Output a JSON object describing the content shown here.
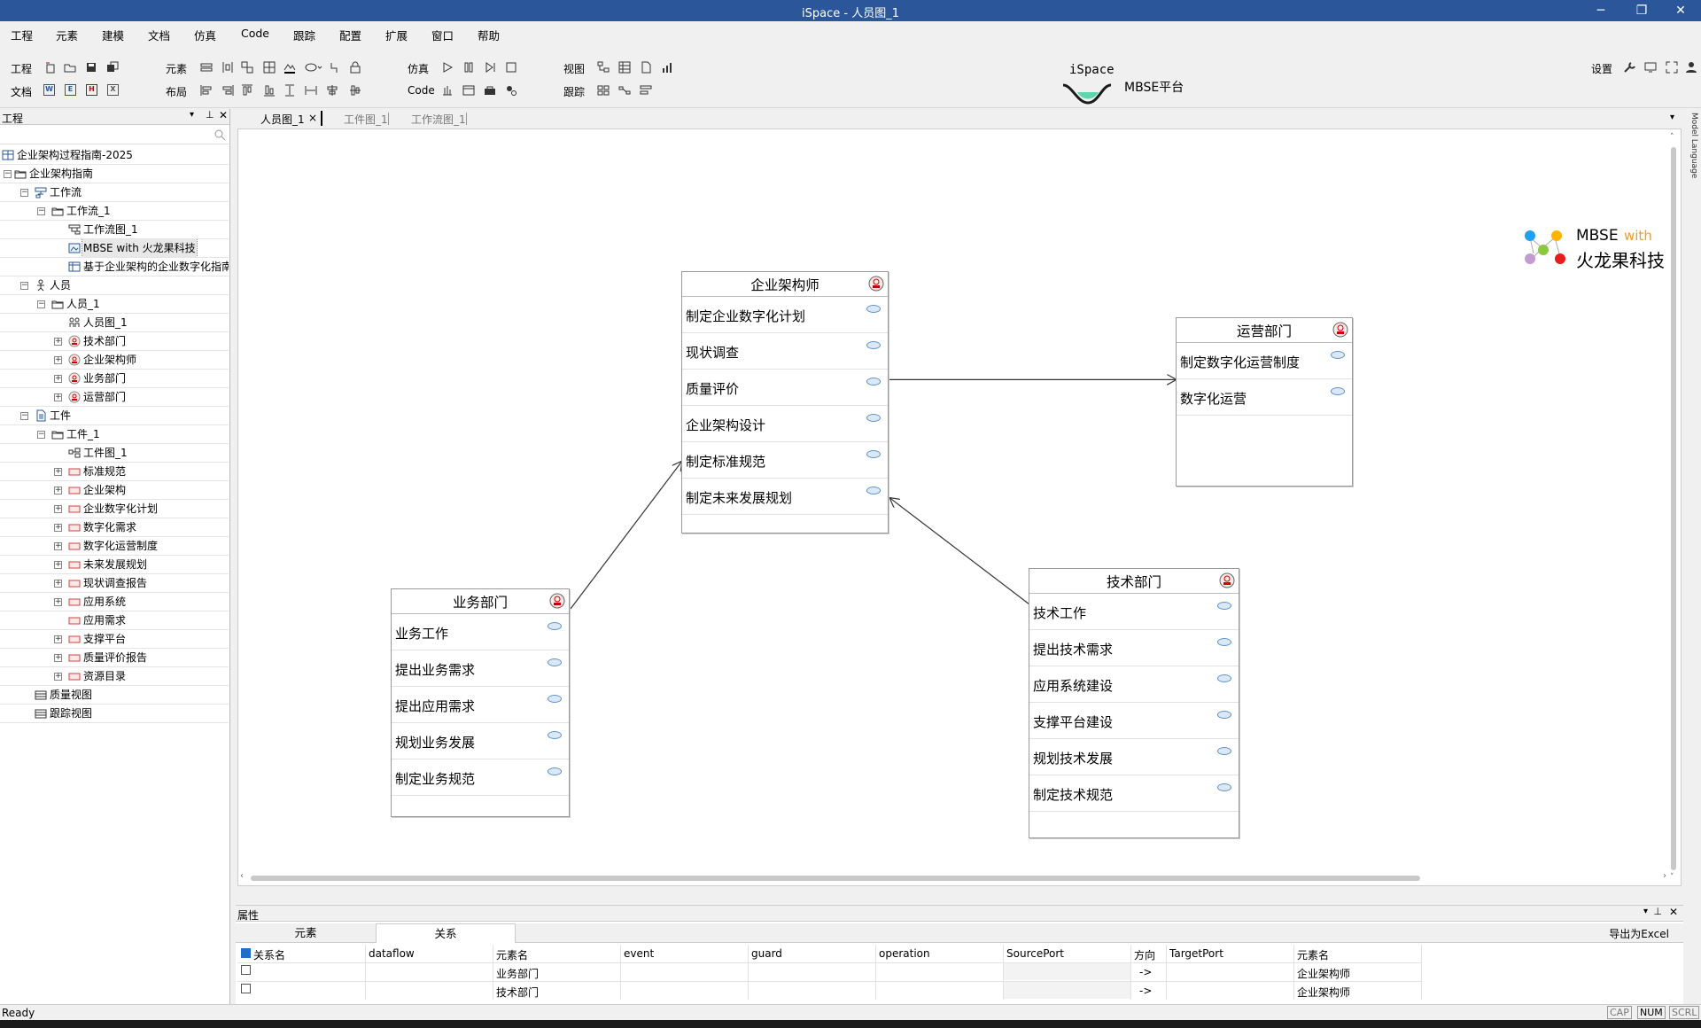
{
  "window": {
    "title": "iSpace - 人员图_1",
    "controls": [
      "─",
      "❐",
      "✕"
    ]
  },
  "menu": [
    "工程",
    "元素",
    "建模",
    "文档",
    "仿真",
    "Code",
    "跟踪",
    "配置",
    "扩展",
    "窗口",
    "帮助"
  ],
  "toolbar": {
    "groups": {
      "project": "工程",
      "document": "文档",
      "element": "元素",
      "layout": "布局",
      "simulate": "仿真",
      "code": "Code",
      "view": "视图",
      "trace": "跟踪"
    },
    "doc_icons": [
      "W",
      "E",
      "H",
      "X"
    ],
    "brand_title": "iSpace",
    "brand_sub": "MBSE平台",
    "settings": "设置"
  },
  "left_panel": {
    "title": "工程",
    "tree": [
      {
        "label": "企业架构过程指南-2025",
        "level": 0,
        "exp": "",
        "icon": "grid-icon"
      },
      {
        "label": "企业架构指南",
        "level": 0,
        "exp": "-",
        "icon": "folder-icon"
      },
      {
        "label": "工作流",
        "level": 1,
        "exp": "-",
        "icon": "workflow-icon"
      },
      {
        "label": "工作流_1",
        "level": 2,
        "exp": "-",
        "icon": "folder-icon"
      },
      {
        "label": "工作流图_1",
        "level": 3,
        "exp": "",
        "icon": "workflow-diagram-icon"
      },
      {
        "label": "MBSE with 火龙果科技",
        "level": 3,
        "exp": "",
        "icon": "image-icon",
        "selected": true
      },
      {
        "label": "基于企业架构的企业数字化指南",
        "level": 3,
        "exp": "",
        "icon": "table-icon"
      },
      {
        "label": "人员",
        "level": 1,
        "exp": "-",
        "icon": "person-icon"
      },
      {
        "label": "人员_1",
        "level": 2,
        "exp": "-",
        "icon": "folder-icon"
      },
      {
        "label": "人员图_1",
        "level": 3,
        "exp": "",
        "icon": "people-diagram-icon"
      },
      {
        "label": "技术部门",
        "level": 3,
        "exp": "+",
        "icon": "role-icon"
      },
      {
        "label": "企业架构师",
        "level": 3,
        "exp": "+",
        "icon": "role-icon"
      },
      {
        "label": "业务部门",
        "level": 3,
        "exp": "+",
        "icon": "role-icon"
      },
      {
        "label": "运营部门",
        "level": 3,
        "exp": "+",
        "icon": "role-icon"
      },
      {
        "label": "工件",
        "level": 1,
        "exp": "-",
        "icon": "artifact-icon"
      },
      {
        "label": "工件_1",
        "level": 2,
        "exp": "-",
        "icon": "folder-icon"
      },
      {
        "label": "工件图_1",
        "level": 3,
        "exp": "",
        "icon": "artifact-diagram-icon"
      },
      {
        "label": "标准规范",
        "level": 3,
        "exp": "+",
        "icon": "artifact-item-icon"
      },
      {
        "label": "企业架构",
        "level": 3,
        "exp": "+",
        "icon": "artifact-item-icon"
      },
      {
        "label": "企业数字化计划",
        "level": 3,
        "exp": "+",
        "icon": "artifact-item-icon"
      },
      {
        "label": "数字化需求",
        "level": 3,
        "exp": "+",
        "icon": "artifact-item-icon"
      },
      {
        "label": "数字化运营制度",
        "level": 3,
        "exp": "+",
        "icon": "artifact-item-icon"
      },
      {
        "label": "未来发展规划",
        "level": 3,
        "exp": "+",
        "icon": "artifact-item-icon"
      },
      {
        "label": "现状调查报告",
        "level": 3,
        "exp": "+",
        "icon": "artifact-item-icon"
      },
      {
        "label": "应用系统",
        "level": 3,
        "exp": "+",
        "icon": "artifact-item-icon"
      },
      {
        "label": "应用需求",
        "level": 3,
        "exp": "",
        "icon": "artifact-item-icon"
      },
      {
        "label": "支撑平台",
        "level": 3,
        "exp": "+",
        "icon": "artifact-item-icon"
      },
      {
        "label": "质量评价报告",
        "level": 3,
        "exp": "+",
        "icon": "artifact-item-icon"
      },
      {
        "label": "资源目录",
        "level": 3,
        "exp": "+",
        "icon": "artifact-item-icon"
      },
      {
        "label": "质量视图",
        "level": 1,
        "exp": "",
        "icon": "view-icon"
      },
      {
        "label": "跟踪视图",
        "level": 1,
        "exp": "",
        "icon": "view-icon"
      }
    ]
  },
  "doc_tabs": [
    {
      "label": "人员图_1",
      "active": true,
      "close": "×"
    },
    {
      "label": "工件图_1",
      "active": false
    },
    {
      "label": "工作流图_1",
      "active": false
    }
  ],
  "right_strip": "Model Language",
  "diagram": {
    "logo": {
      "line1a": "MBSE",
      "line1b": "with",
      "line2": "火龙果科技"
    },
    "nodes": [
      {
        "id": "arch",
        "title": "企业架构师",
        "rows": [
          "制定企业数字化计划",
          "现状调查",
          "质量评价",
          "企业架构设计",
          "制定标准规范",
          "制定未来发展规划"
        ]
      },
      {
        "id": "ops",
        "title": "运营部门",
        "rows": [
          "制定数字化运营制度",
          "数字化运营"
        ]
      },
      {
        "id": "biz",
        "title": "业务部门",
        "rows": [
          "业务工作",
          "提出业务需求",
          "提出应用需求",
          "规划业务发展",
          "制定业务规范"
        ]
      },
      {
        "id": "tech",
        "title": "技术部门",
        "rows": [
          "技术工作",
          "提出技术需求",
          "应用系统建设",
          "支撑平台建设",
          "规划技术发展",
          "制定技术规范"
        ]
      }
    ],
    "edges": [
      {
        "from": "arch",
        "to": "ops"
      },
      {
        "from": "biz",
        "to": "arch"
      },
      {
        "from": "tech",
        "to": "arch"
      }
    ]
  },
  "properties": {
    "title": "属性",
    "tabs": [
      {
        "label": "元素",
        "active": false
      },
      {
        "label": "关系",
        "active": true
      }
    ],
    "export": "导出为Excel",
    "columns": [
      "关系名",
      "dataflow",
      "元素名",
      "event",
      "guard",
      "operation",
      "SourcePort",
      "方向",
      "TargetPort",
      "元素名"
    ],
    "rows": [
      {
        "checked": false,
        "cells": [
          "",
          "",
          "业务部门",
          "",
          "",
          "",
          "",
          "->",
          "",
          "企业架构师"
        ]
      },
      {
        "checked": false,
        "cells": [
          "",
          "",
          "技术部门",
          "",
          "",
          "",
          "",
          "->",
          "",
          "企业架构师"
        ]
      }
    ]
  },
  "status": {
    "text": "Ready",
    "indicators": [
      {
        "label": "CAP",
        "on": false
      },
      {
        "label": "NUM",
        "on": true
      },
      {
        "label": "SCRL",
        "on": false
      }
    ]
  }
}
